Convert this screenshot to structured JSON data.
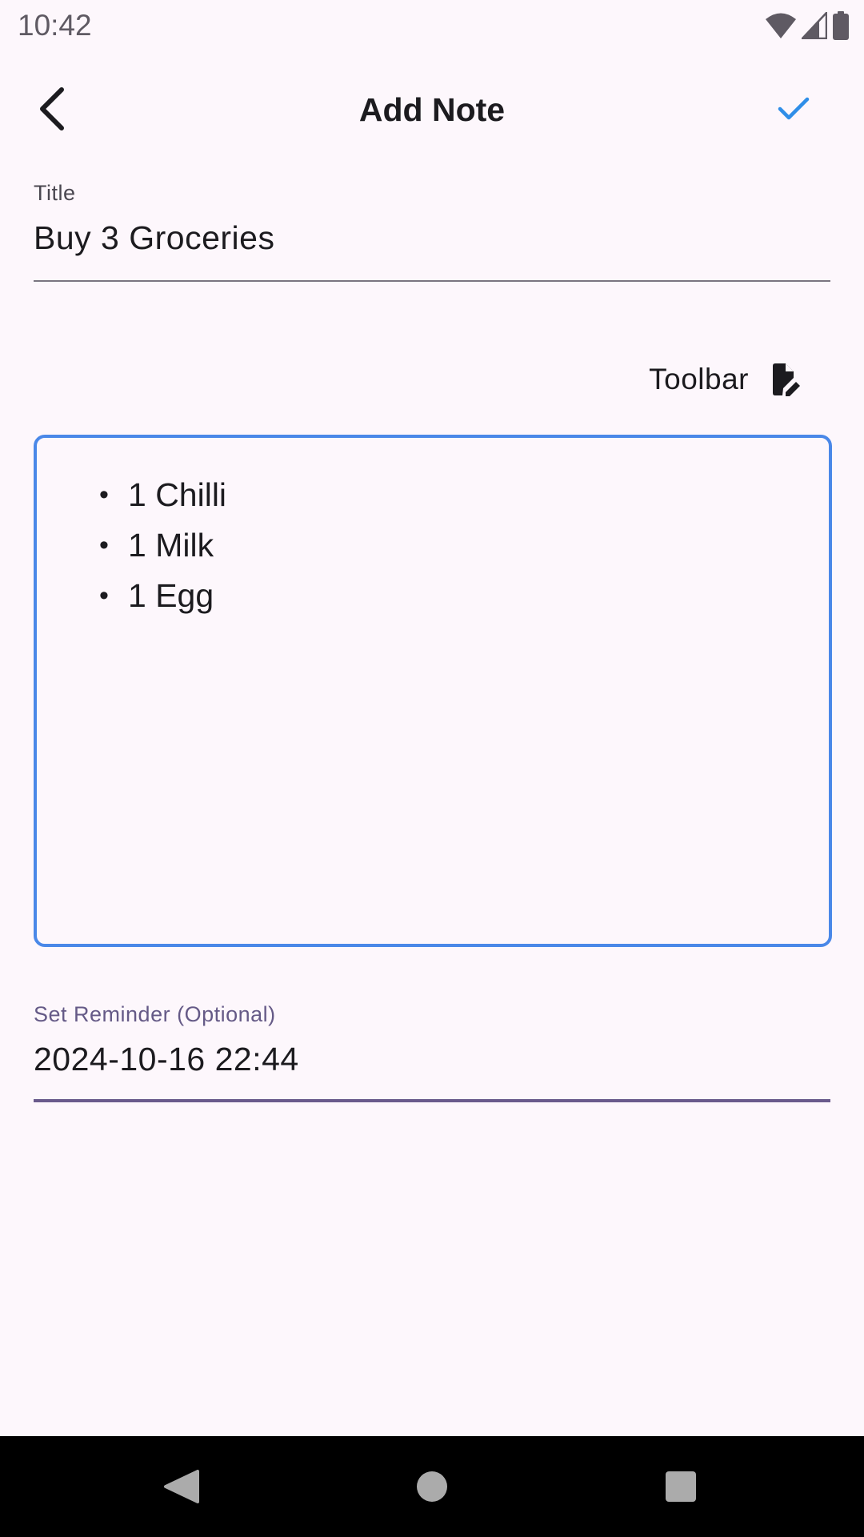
{
  "status_bar": {
    "time": "10:42",
    "icons": [
      "wifi-icon",
      "cellular-signal-icon",
      "battery-icon"
    ]
  },
  "app_bar": {
    "title": "Add Note",
    "back_icon": "chevron-left-icon",
    "save_icon": "check-icon",
    "save_color": "#2f8ee8"
  },
  "title_field": {
    "label": "Title",
    "value": "Buy 3 Groceries"
  },
  "toolbar_toggle": {
    "label": "Toolbar",
    "icon": "edit-document-icon"
  },
  "editor": {
    "border_color": "#4a88e8",
    "bullet": "•",
    "items": [
      {
        "text": "1 Chilli"
      },
      {
        "text": "1 Milk"
      },
      {
        "text": "1 Egg"
      }
    ]
  },
  "reminder_field": {
    "label": "Set Reminder (Optional)",
    "value": "2024-10-16 22:44",
    "accent_color": "#6a5a8c"
  },
  "nav_bar": {
    "icons": [
      "back-triangle-icon",
      "home-circle-icon",
      "recents-square-icon"
    ]
  }
}
